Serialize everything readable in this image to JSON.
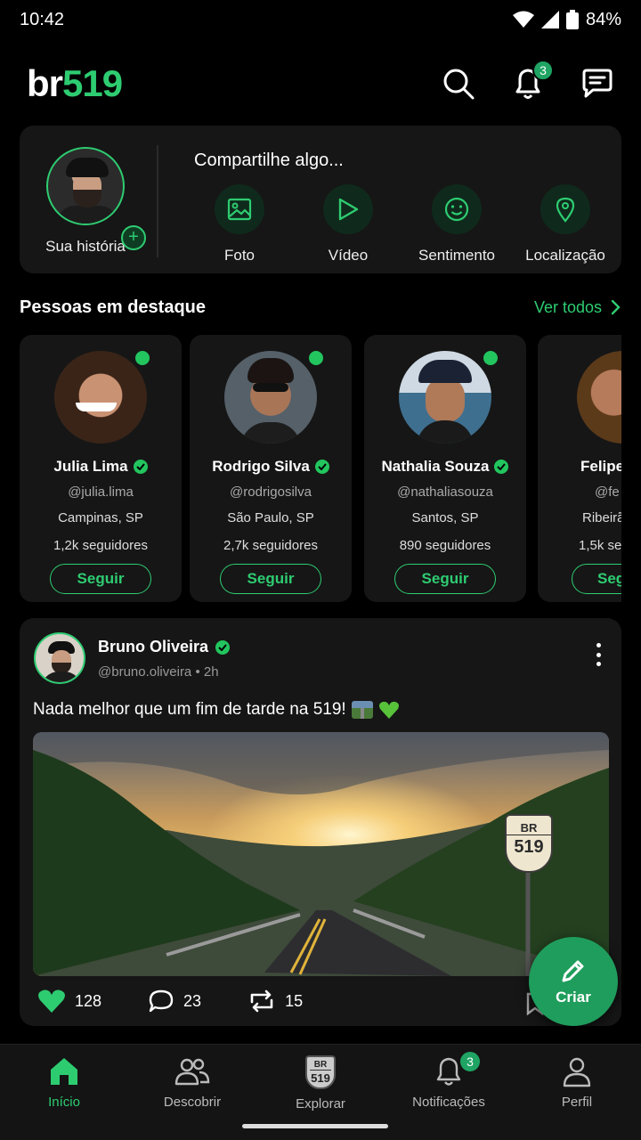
{
  "status": {
    "time": "10:42",
    "battery": "84%"
  },
  "header": {
    "logo_prefix": "br",
    "logo_number": "519",
    "notifications_count": "3"
  },
  "share": {
    "story_label": "Sua história",
    "title": "Compartilhe algo...",
    "actions": [
      {
        "label": "Foto",
        "icon": "image-icon"
      },
      {
        "label": "Vídeo",
        "icon": "play-icon"
      },
      {
        "label": "Sentimento",
        "icon": "smile-icon"
      },
      {
        "label": "Localização",
        "icon": "location-pin-icon"
      }
    ]
  },
  "featured": {
    "title": "Pessoas em destaque",
    "see_all": "Ver todos",
    "people": [
      {
        "name": "Julia Lima",
        "handle": "@julia.lima",
        "location": "Campinas, SP",
        "followers": "1,2k seguidores",
        "follow": "Seguir"
      },
      {
        "name": "Rodrigo Silva",
        "handle": "@rodrigosilva",
        "location": "São Paulo, SP",
        "followers": "2,7k seguidores",
        "follow": "Seguir"
      },
      {
        "name": "Nathalia Souza",
        "handle": "@nathaliasouza",
        "location": "Santos, SP",
        "followers": "890 seguidores",
        "follow": "Seguir"
      },
      {
        "name": "Felipe",
        "handle": "@fe",
        "location": "Ribeirã",
        "followers": "1,5k se",
        "follow": "Seg"
      }
    ]
  },
  "post": {
    "author": "Bruno Oliveira",
    "handle": "@bruno.oliveira",
    "time": "2h",
    "text": "Nada melhor que um fim de tarde na 519!",
    "sign_top": "BR",
    "sign_number": "519",
    "likes": "128",
    "comments": "23",
    "reposts": "15"
  },
  "fab": {
    "label": "Criar"
  },
  "nav": {
    "items": [
      {
        "label": "Início",
        "active": true
      },
      {
        "label": "Descobrir"
      },
      {
        "label": "Explorar"
      },
      {
        "label": "Notificações",
        "badge": "3"
      },
      {
        "label": "Perfil"
      }
    ]
  },
  "colors": {
    "accent": "#2ecc71",
    "background": "#000000",
    "card": "#161616"
  }
}
